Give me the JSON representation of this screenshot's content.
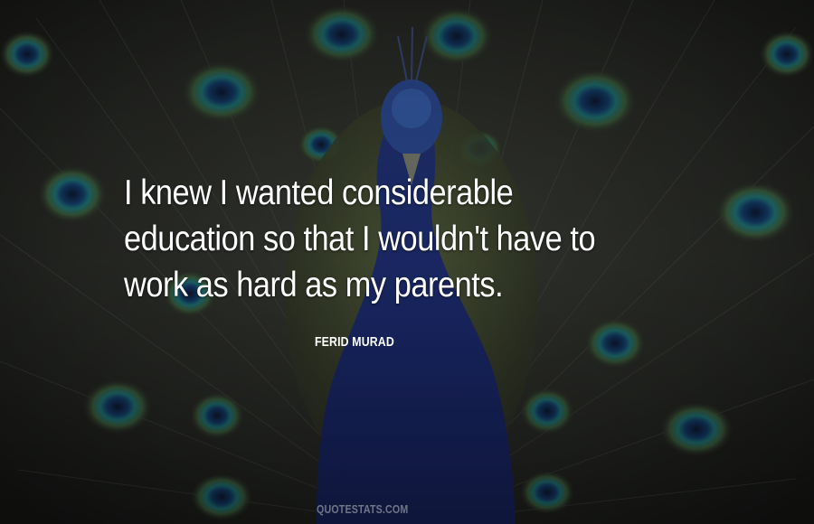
{
  "quote": {
    "lines": [
      "I knew I wanted considerable",
      "education so that I wouldn't have to",
      "work as hard as my parents."
    ]
  },
  "author": "FERID MURAD",
  "watermark": "QUOTESTATS.COM",
  "colors": {
    "background": "#232522",
    "text": "#ffffff",
    "peacock_body": "#1c2c78",
    "eye_teal": "#1a6e70",
    "eye_dark": "#0e1a3a",
    "watermark": "#6e7687"
  }
}
